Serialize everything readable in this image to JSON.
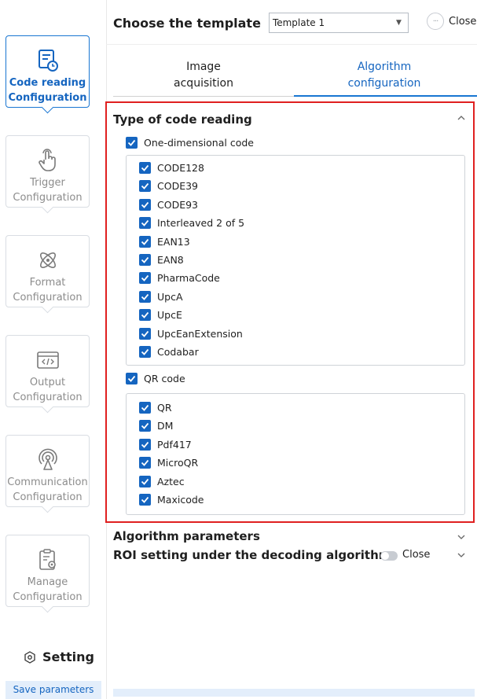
{
  "header": {
    "title": "Choose the template",
    "template_value": "Template 1",
    "close_label": "Close"
  },
  "sidebar": {
    "items": [
      {
        "line1": "Code reading",
        "line2": "Configuration",
        "icon": "document-clock-icon",
        "active": true
      },
      {
        "line1": "Trigger",
        "line2": "Configuration",
        "icon": "hand-pointer-icon",
        "active": false
      },
      {
        "line1": "Format",
        "line2": "Configuration",
        "icon": "atom-icon",
        "active": false
      },
      {
        "line1": "Output",
        "line2": "Configuration",
        "icon": "code-window-icon",
        "active": false
      },
      {
        "line1": "Communication",
        "line2": "Configuration",
        "icon": "broadcast-icon",
        "active": false
      },
      {
        "line1": "Manage",
        "line2": "Configuration",
        "icon": "clipboard-gear-icon",
        "active": false
      }
    ],
    "setting_label": "Setting",
    "save_label": "Save parameters"
  },
  "tabs": [
    {
      "line1": "Image",
      "line2": "acquisition"
    },
    {
      "line1": "Algorithm",
      "line2": "configuration"
    }
  ],
  "code_reading": {
    "title": "Type of code reading",
    "one_d": {
      "label": "One-dimensional code",
      "checked": true,
      "items": [
        "CODE128",
        "CODE39",
        "CODE93",
        "Interleaved 2 of 5",
        "EAN13",
        "EAN8",
        "PharmaCode",
        "UpcA",
        "UpcE",
        "UpcEanExtension",
        "Codabar"
      ]
    },
    "qr": {
      "label": "QR code",
      "checked": true,
      "items": [
        "QR",
        "DM",
        "Pdf417",
        "MicroQR",
        "Aztec",
        "Maxicode"
      ]
    }
  },
  "algorithm_params": {
    "title": "Algorithm parameters"
  },
  "roi": {
    "title": "ROI setting under the decoding algorithm",
    "toggle_label": "Close",
    "enabled": false
  },
  "colors": {
    "accent": "#1565c0",
    "highlight": "#e02020"
  }
}
